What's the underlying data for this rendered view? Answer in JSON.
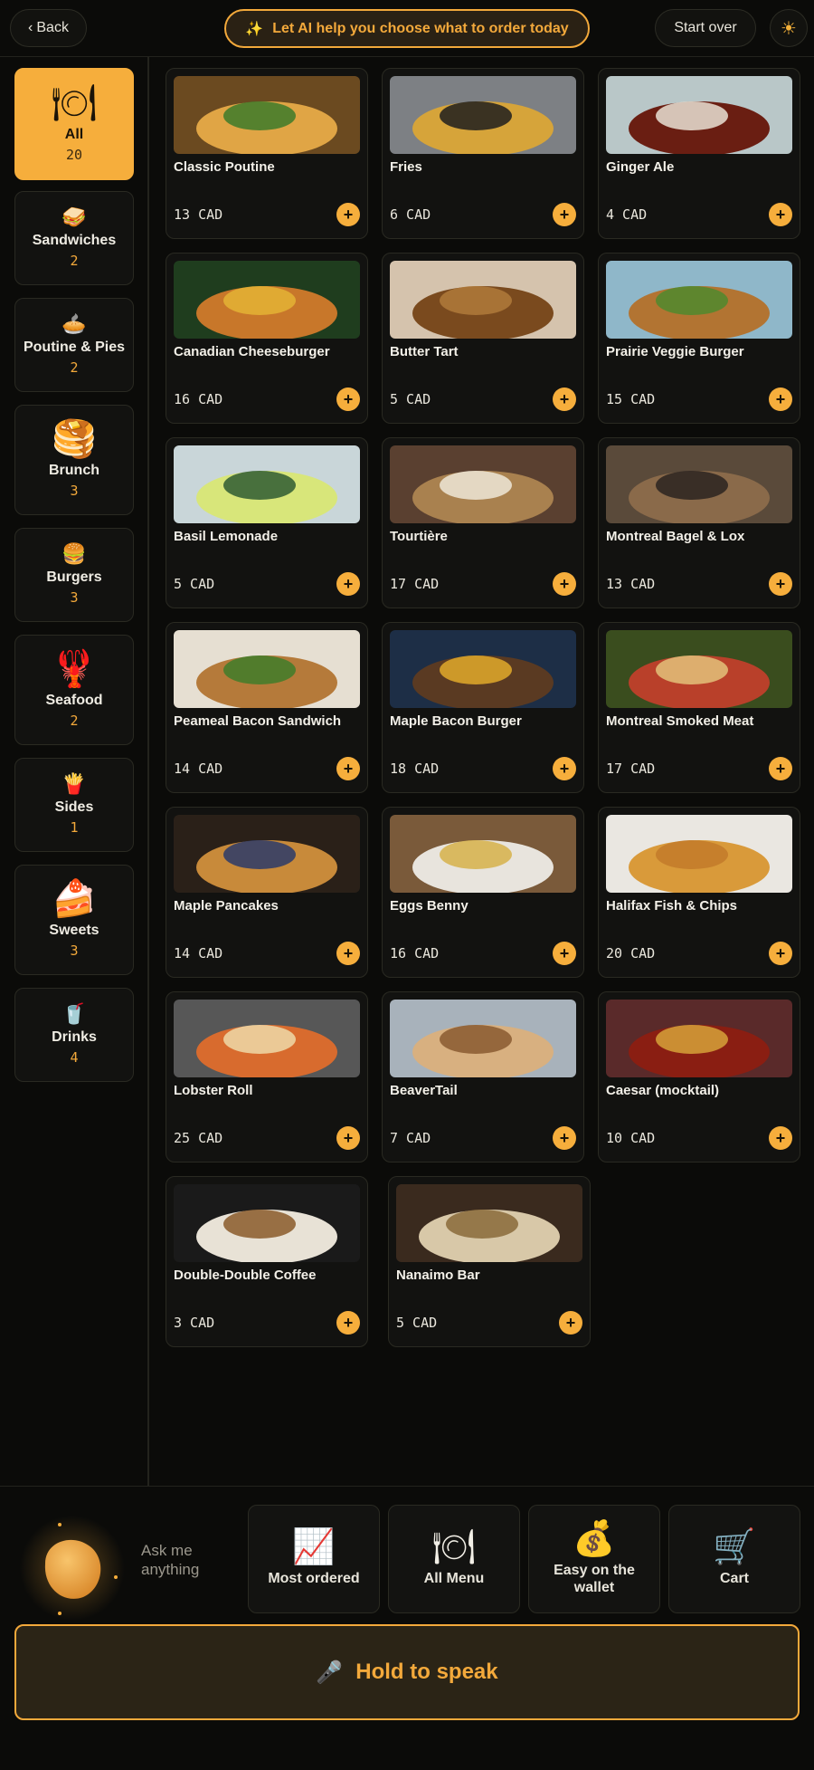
{
  "header": {
    "back_label": "Back",
    "ai_label": "Let AI help you choose what to order today",
    "start_over_label": "Start over",
    "theme_icon": "sun-icon"
  },
  "colors": {
    "accent": "#f6ae3c",
    "background": "#0b0b09",
    "card": "#121210"
  },
  "categories": [
    {
      "name": "All",
      "count": "20",
      "icon": "plate-icon",
      "active": true
    },
    {
      "name": "Sandwiches",
      "count": "2",
      "icon": "sandwich-icon"
    },
    {
      "name": "Poutine & Pies",
      "count": "2",
      "icon": "pie-icon"
    },
    {
      "name": "Brunch",
      "count": "3",
      "icon": "pancakes-icon"
    },
    {
      "name": "Burgers",
      "count": "3",
      "icon": "burger-icon"
    },
    {
      "name": "Seafood",
      "count": "2",
      "icon": "lobster-icon"
    },
    {
      "name": "Sides",
      "count": "1",
      "icon": "fries-icon"
    },
    {
      "name": "Sweets",
      "count": "3",
      "icon": "cake-icon"
    },
    {
      "name": "Drinks",
      "count": "4",
      "icon": "cup-icon"
    }
  ],
  "menu": [
    {
      "name": "Classic Poutine",
      "price": "13 CAD"
    },
    {
      "name": "Fries",
      "price": "6 CAD"
    },
    {
      "name": "Ginger Ale",
      "price": "4 CAD"
    },
    {
      "name": "Canadian Cheeseburger",
      "price": "16 CAD"
    },
    {
      "name": "Butter Tart",
      "price": "5 CAD"
    },
    {
      "name": "Prairie Veggie Burger",
      "price": "15 CAD"
    },
    {
      "name": "Basil Lemonade",
      "price": "5 CAD"
    },
    {
      "name": "Tourtière",
      "price": "17 CAD"
    },
    {
      "name": "Montreal Bagel & Lox",
      "price": "13 CAD"
    },
    {
      "name": "Peameal Bacon Sandwich",
      "price": "14 CAD"
    },
    {
      "name": "Maple Bacon Burger",
      "price": "18 CAD"
    },
    {
      "name": "Montreal Smoked Meat",
      "price": "17 CAD"
    },
    {
      "name": "Maple Pancakes",
      "price": "14 CAD"
    },
    {
      "name": "Eggs Benny",
      "price": "16 CAD"
    },
    {
      "name": "Halifax Fish & Chips",
      "price": "20 CAD"
    },
    {
      "name": "Lobster Roll",
      "price": "25 CAD"
    },
    {
      "name": "BeaverTail",
      "price": "7 CAD"
    },
    {
      "name": "Caesar (mocktail)",
      "price": "10 CAD"
    },
    {
      "name": "Double-Double Coffee",
      "price": "3 CAD"
    },
    {
      "name": "Nanaimo Bar",
      "price": "5 CAD"
    }
  ],
  "assistant": {
    "ask_label": "Ask me anything"
  },
  "quick_actions": [
    {
      "label": "Most ordered",
      "icon": "chart-icon"
    },
    {
      "label": "All Menu",
      "icon": "plate-icon"
    },
    {
      "label": "Easy on the wallet",
      "icon": "money-bag-icon"
    },
    {
      "label": "Cart",
      "icon": "cart-icon"
    }
  ],
  "voice": {
    "hold_label": "Hold to speak"
  }
}
